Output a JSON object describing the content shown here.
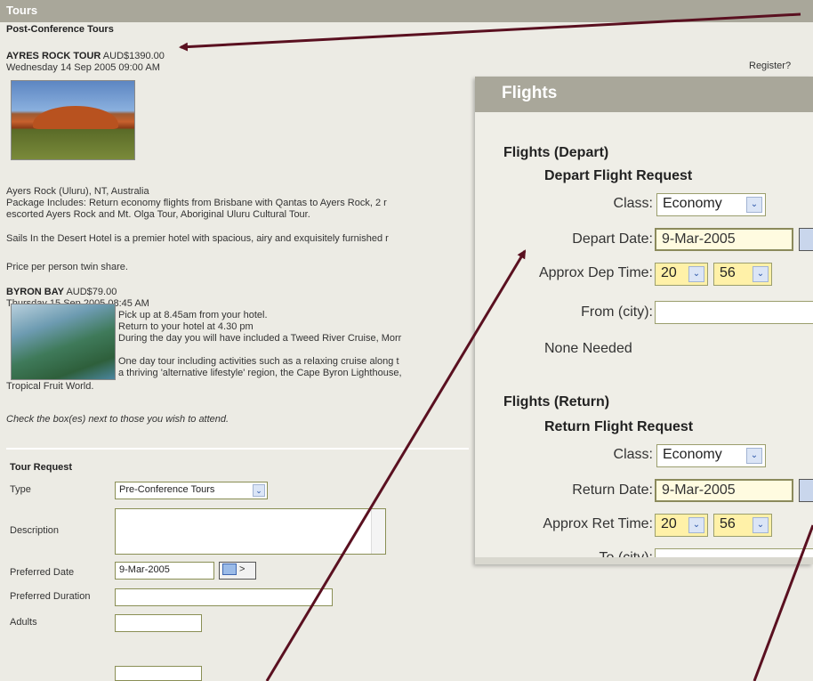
{
  "tours": {
    "header": "Tours",
    "section_title": "Post-Conference Tours",
    "register": "Register?",
    "tour1": {
      "name": "AYRES ROCK TOUR",
      "price": " AUD$1390.00",
      "datetime": "Wednesday 14 Sep 2005 09:00 AM",
      "location": "Ayers Rock (Uluru), NT, Australia",
      "package_line1": "Package Includes: Return economy flights from Brisbane with Qantas to Ayers Rock, 2 r",
      "package_line2": "escorted Ayers Rock and Mt. Olga Tour, Aboriginal Uluru Cultural Tour.",
      "hotel": "Sails In the Desert Hotel is a premier hotel with spacious, airy and exquisitely furnished r",
      "price_note": "Price per person twin share."
    },
    "tour2": {
      "name": "BYRON BAY",
      "price": " AUD$79.00",
      "datetime": "Thursday 15 Sep 2005 08:45 AM",
      "line1": "Pick up at 8.45am from your hotel.",
      "line2": "Return to your hotel at 4.30 pm",
      "line3": "During the day you will have included a Tweed River Cruise, Morr",
      "line4": "One day tour including activities such as a relaxing cruise along t",
      "line5": "a thriving 'alternative lifestyle' region, the Cape Byron Lighthouse,",
      "line6": "Tropical Fruit World."
    },
    "check_note": "Check the box(es) next to those you wish to attend.",
    "form": {
      "title": "Tour Request",
      "type_label": "Type",
      "type_value": "Pre-Conference Tours",
      "description_label": "Description",
      "preferred_date_label": "Preferred Date",
      "preferred_date_value": "9-Mar-2005",
      "cal_arrow": ">",
      "preferred_duration_label": "Preferred Duration",
      "adults_label": "Adults"
    }
  },
  "flights": {
    "header": "Flights",
    "depart_section": "Flights (Depart)",
    "depart_request": "Depart Flight Request",
    "class_label": "Class:",
    "class_value": "Economy",
    "depart_date_label": "Depart Date:",
    "depart_date_value": "9-Mar-2005",
    "dep_time_label": "Approx Dep Time:",
    "dep_hour": "20",
    "dep_min": "56",
    "from_label": "From (city):",
    "none_needed": "None Needed",
    "return_section": "Flights (Return)",
    "return_request": "Return Flight Request",
    "return_class_label": "Class:",
    "return_class_value": "Economy",
    "return_date_label": "Return Date:",
    "return_date_value": "9-Mar-2005",
    "ret_time_label": "Approx Ret Time:",
    "ret_hour": "20",
    "ret_min": "56",
    "to_label": "To (city):"
  },
  "colors": {
    "header_bg": "#a9a79a",
    "annotation_arrow": "#5a1020",
    "highlight_yellow": "#fff1a8"
  }
}
